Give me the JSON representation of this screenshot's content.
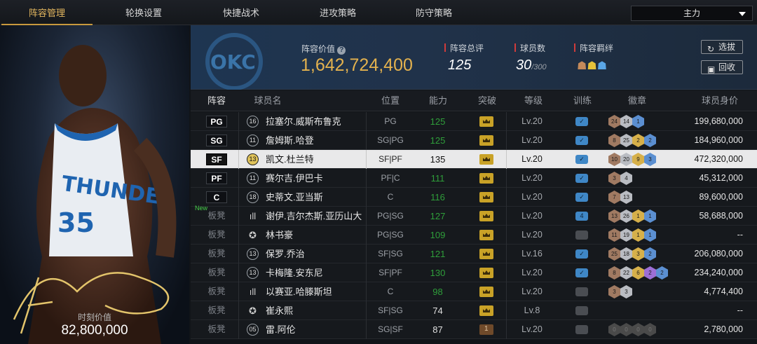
{
  "tabs": [
    "阵容管理",
    "轮换设置",
    "快捷战术",
    "进攻策略",
    "防守策略"
  ],
  "lineup_select": "主力",
  "portrait": {
    "market_value_label": "时刻价值",
    "market_value": "82,800,000"
  },
  "header": {
    "lineup_value_label": "阵容价值",
    "lineup_value": "1,642,724,400",
    "overall_label": "阵容总评",
    "overall": "125",
    "players_label": "球员数",
    "players": "30",
    "players_max": "/300",
    "bonds_label": "阵容羁绊",
    "btn_select": "选拔",
    "btn_recycle": "回收"
  },
  "columns": [
    "阵容",
    "球员名",
    "位置",
    "能力",
    "突破",
    "等级",
    "训练",
    "徽章",
    "球员身价"
  ],
  "rows": [
    {
      "slot": "PG",
      "starter": true,
      "num": "16",
      "name": "拉塞尔.威斯布鲁克",
      "pos": "PG",
      "ability": "125",
      "breakthrough": "gold",
      "level": "Lv.20",
      "train": "✓",
      "badges": [
        [
          "24",
          "b-br"
        ],
        [
          "14",
          "b-si"
        ],
        [
          "1",
          "b-bl"
        ]
      ],
      "value": "199,680,000"
    },
    {
      "slot": "SG",
      "starter": true,
      "num": "11",
      "name": "詹姆斯.哈登",
      "pos": "SG|PG",
      "ability": "125",
      "breakthrough": "gold",
      "level": "Lv.20",
      "train": "✓",
      "badges": [
        [
          "8",
          "b-br"
        ],
        [
          "25",
          "b-si"
        ],
        [
          "2",
          "b-go"
        ],
        [
          "2",
          "b-bl"
        ]
      ],
      "value": "184,960,000"
    },
    {
      "slot": "SF",
      "starter": true,
      "selected": true,
      "num": "13",
      "name": "凯文.杜兰特",
      "pos": "SF|PF",
      "ability": "135",
      "breakthrough": "gold",
      "level": "Lv.20",
      "train": "✓",
      "badges": [
        [
          "10",
          "b-br"
        ],
        [
          "20",
          "b-si"
        ],
        [
          "9",
          "b-go"
        ],
        [
          "3",
          "b-bl"
        ]
      ],
      "value": "472,320,000"
    },
    {
      "slot": "PF",
      "starter": true,
      "num": "11",
      "name": "赛尔吉.伊巴卡",
      "pos": "PF|C",
      "ability": "111",
      "breakthrough": "gold",
      "level": "Lv.20",
      "train": "✓",
      "badges": [
        [
          "3",
          "b-br"
        ],
        [
          "4",
          "b-si"
        ]
      ],
      "value": "45,312,000"
    },
    {
      "slot": "C",
      "starter": true,
      "num": "18",
      "name": "史蒂文.亚当斯",
      "pos": "C",
      "ability": "116",
      "breakthrough": "gold",
      "level": "Lv.20",
      "train": "✓",
      "badges": [
        [
          "7",
          "b-br"
        ],
        [
          "13",
          "b-si"
        ]
      ],
      "value": "89,600,000"
    },
    {
      "slot": "板凳",
      "starter": false,
      "new": "New",
      "sym": "ıll",
      "name": "谢伊.吉尔杰斯.亚历山大",
      "pos": "PG|SG",
      "ability": "127",
      "breakthrough": "gold",
      "level": "Lv.20",
      "train": "4",
      "badges": [
        [
          "13",
          "b-br"
        ],
        [
          "26",
          "b-si"
        ],
        [
          "1",
          "b-go"
        ],
        [
          "1",
          "b-bl"
        ]
      ],
      "value": "58,688,000"
    },
    {
      "slot": "板凳",
      "starter": false,
      "sym": "✪",
      "name": "林书豪",
      "pos": "PG|SG",
      "ability": "109",
      "breakthrough": "gold",
      "level": "Lv.20",
      "train": "",
      "badges": [
        [
          "11",
          "b-br"
        ],
        [
          "19",
          "b-si"
        ],
        [
          "1",
          "b-go"
        ],
        [
          "1",
          "b-bl"
        ]
      ],
      "value": "--"
    },
    {
      "slot": "板凳",
      "starter": false,
      "num": "13",
      "name": "保罗.乔治",
      "pos": "SF|SG",
      "ability": "121",
      "breakthrough": "gold",
      "level": "Lv.16",
      "train": "✓",
      "badges": [
        [
          "25",
          "b-br"
        ],
        [
          "18",
          "b-si"
        ],
        [
          "3",
          "b-go"
        ],
        [
          "2",
          "b-bl"
        ]
      ],
      "value": "206,080,000"
    },
    {
      "slot": "板凳",
      "starter": false,
      "num": "13",
      "name": "卡梅隆.安东尼",
      "pos": "SF|PF",
      "ability": "130",
      "breakthrough": "gold",
      "level": "Lv.20",
      "train": "✓",
      "badges": [
        [
          "8",
          "b-br"
        ],
        [
          "22",
          "b-si"
        ],
        [
          "6",
          "b-go"
        ],
        [
          "2",
          "b-pu"
        ],
        [
          "2",
          "b-bl"
        ]
      ],
      "value": "234,240,000"
    },
    {
      "slot": "板凳",
      "starter": false,
      "sym": "ıll",
      "name": "以赛亚.哈滕斯坦",
      "pos": "C",
      "ability": "98",
      "breakthrough": "gold",
      "level": "Lv.20",
      "train": "",
      "badges": [
        [
          "3",
          "b-br"
        ],
        [
          "3",
          "b-si"
        ]
      ],
      "value": "4,774,400"
    },
    {
      "slot": "板凳",
      "starter": false,
      "sym": "✪",
      "name": "崔永熙",
      "pos": "SF|SG",
      "ability": "74",
      "breakthrough": "gold",
      "level": "Lv.8",
      "train": "",
      "badges": [],
      "value": "--"
    },
    {
      "slot": "板凳",
      "starter": false,
      "num": "05",
      "name": "雷.阿伦",
      "pos": "SG|SF",
      "ability": "87",
      "breakthrough": "brown",
      "level": "Lv.20",
      "train": "",
      "badges": [
        [
          "0",
          "b-dk"
        ],
        [
          "0",
          "b-dk"
        ],
        [
          "0",
          "b-dk"
        ],
        [
          "0",
          "b-dk"
        ]
      ],
      "value": "2,780,000"
    }
  ]
}
